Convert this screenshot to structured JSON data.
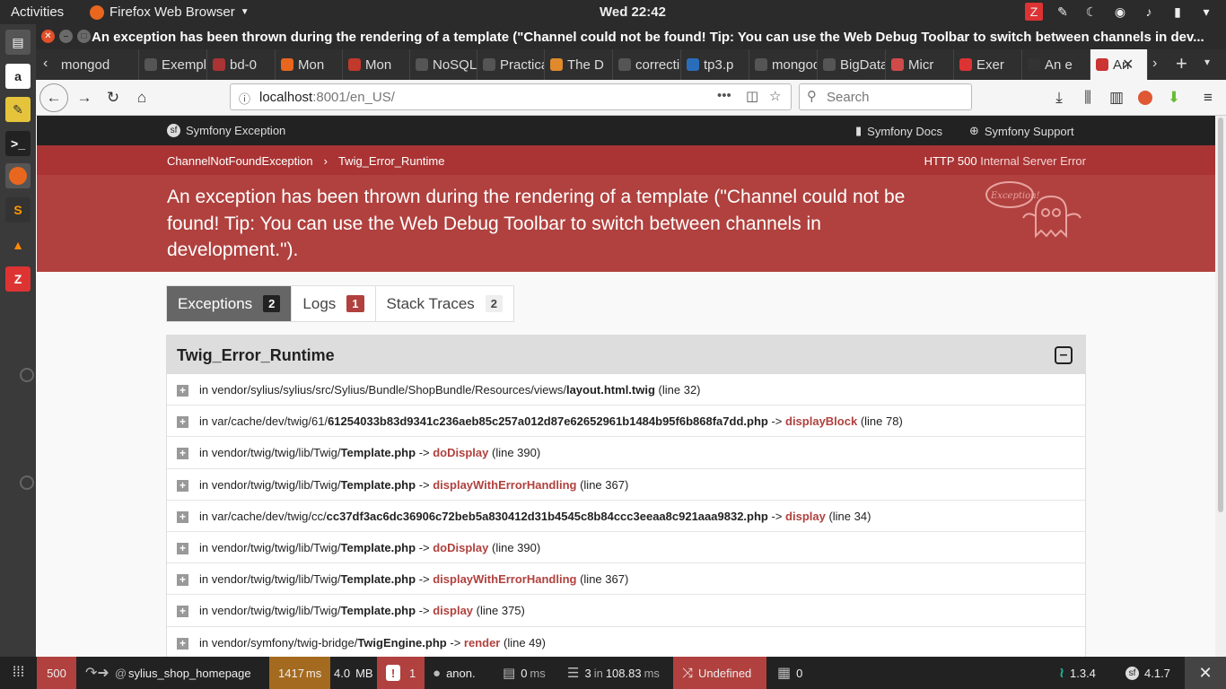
{
  "gnome": {
    "activities": "Activities",
    "app_name": "Firefox Web Browser",
    "clock": "Wed 22:42"
  },
  "window": {
    "title": "An exception has been thrown during the rendering of a template (\"Channel could not be found! Tip: You can use the Web Debug Toolbar to switch between channels in dev..."
  },
  "tabs": [
    {
      "label": "mongod",
      "color": "#555555"
    },
    {
      "label": "Exemple",
      "color": "#555555"
    },
    {
      "label": "bd-0",
      "color": "#a33"
    },
    {
      "label": "Mon",
      "color": "#e8661e"
    },
    {
      "label": "Mon",
      "color": "#c0392b"
    },
    {
      "label": "NoSQL",
      "color": "#555555"
    },
    {
      "label": "Practica",
      "color": "#555555"
    },
    {
      "label": "The D",
      "color": "#e08a2c"
    },
    {
      "label": "correcti",
      "color": "#555555"
    },
    {
      "label": "tp3.p",
      "color": "#2a6ebb"
    },
    {
      "label": "mongod",
      "color": "#555555"
    },
    {
      "label": "BigData",
      "color": "#555555"
    },
    {
      "label": "Micr",
      "color": "#d04a4a"
    },
    {
      "label": "Exer",
      "color": "#d33"
    },
    {
      "label": "An e",
      "color": "#333"
    },
    {
      "label": "An",
      "color": "#c33"
    }
  ],
  "url": {
    "host": "localhost",
    "rest": ":8001/en_US/"
  },
  "search": {
    "placeholder": "Search"
  },
  "sf": {
    "brand": "Symfony Exception",
    "docs": "Symfony Docs",
    "support": "Symfony Support",
    "crumb1": "ChannelNotFoundException",
    "crumb2": "Twig_Error_Runtime",
    "status_code": "HTTP 500",
    "status_text": "Internal Server Error",
    "message": "An exception has been thrown during the rendering of a template (\"Channel could not be found! Tip: You can use the Web Debug Toolbar to switch between channels in development.\").",
    "ghost_label": "Exception!"
  },
  "ex_tabs": [
    {
      "label": "Exceptions",
      "count": "2",
      "count_bg": "#222",
      "count_fg": "#fff"
    },
    {
      "label": "Logs",
      "count": "1",
      "count_bg": "#b0413e",
      "count_fg": "#fff"
    },
    {
      "label": "Stack Traces",
      "count": "2",
      "count_bg": "#eee",
      "count_fg": "#444"
    }
  ],
  "panel": {
    "title": "Twig_Error_Runtime",
    "rows": [
      {
        "path": "in vendor/sylius/sylius/src/Sylius/Bundle/ShopBundle/Resources/views/",
        "file": "layout.html.twig",
        "arrow": "",
        "fn": "",
        "line": "(line 32)"
      },
      {
        "path": "in var/cache/dev/twig/61/",
        "file": "61254033b83d9341c236aeb85c257a012d87e62652961b1484b95f6b868fa7dd.php",
        "arrow": "->",
        "fn": "displayBlock",
        "line": "(line 78)"
      },
      {
        "path": "in vendor/twig/twig/lib/Twig/",
        "file": "Template.php",
        "arrow": "->",
        "fn": "doDisplay",
        "line": "(line 390)"
      },
      {
        "path": "in vendor/twig/twig/lib/Twig/",
        "file": "Template.php",
        "arrow": "->",
        "fn": "displayWithErrorHandling",
        "line": "(line 367)"
      },
      {
        "path": "in var/cache/dev/twig/cc/",
        "file": "cc37df3ac6dc36906c72beb5a830412d31b4545c8b84ccc3eeaa8c921aaa9832.php",
        "arrow": "->",
        "fn": "display",
        "line": "(line 34)"
      },
      {
        "path": "in vendor/twig/twig/lib/Twig/",
        "file": "Template.php",
        "arrow": "->",
        "fn": "doDisplay",
        "line": "(line 390)"
      },
      {
        "path": "in vendor/twig/twig/lib/Twig/",
        "file": "Template.php",
        "arrow": "->",
        "fn": "displayWithErrorHandling",
        "line": "(line 367)"
      },
      {
        "path": "in vendor/twig/twig/lib/Twig/",
        "file": "Template.php",
        "arrow": "->",
        "fn": "display",
        "line": "(line 375)"
      },
      {
        "path": "in vendor/symfony/twig-bridge/",
        "file": "TwigEngine.php",
        "arrow": "->",
        "fn": "render",
        "line": "(line 49)"
      }
    ]
  },
  "toolbar": {
    "status": "500",
    "route_at": "@",
    "route": "sylius_shop_homepage",
    "time": "1417",
    "time_unit": "ms",
    "memory": "4.0",
    "memory_unit": "MB",
    "logs": "1",
    "user": "anon.",
    "forms_ms": "0",
    "forms_unit": "ms",
    "db_queries": "3",
    "db_in": "in",
    "db_time": "108.83",
    "db_unit": "ms",
    "channel": "Undefined",
    "cache": "0",
    "sylius_version": "1.3.4",
    "sf_version": "4.1.7"
  }
}
